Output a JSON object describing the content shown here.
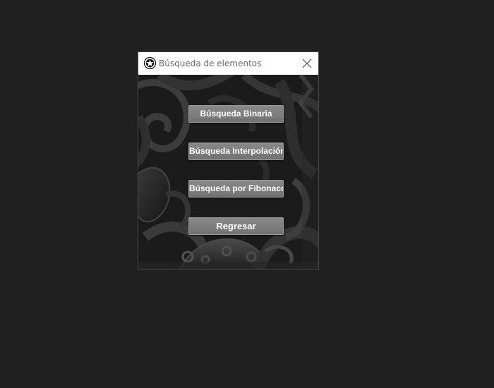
{
  "window": {
    "title": "Búsqueda de elementos",
    "icon": "app-logo-icon",
    "close_icon": "close-icon"
  },
  "buttons": {
    "binary": "Búsqueda Binaria",
    "interpolation": "Búsqueda Interpolación",
    "fibonacci": "Búsqueda por Fibonacci",
    "back": "Regresar"
  },
  "colors": {
    "desktop": "#202020",
    "titlebar": "#ffffff",
    "title_text": "#6b6b6b",
    "button": "#7d7d7d",
    "button_text": "#ffffff",
    "background_pattern": "#2a2a2a"
  }
}
